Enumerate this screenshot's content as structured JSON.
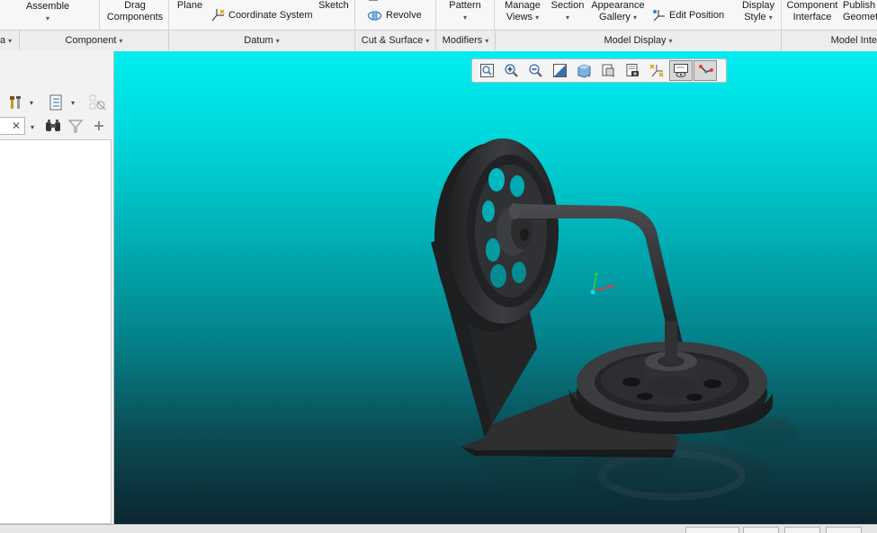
{
  "ribbon": {
    "buttons": {
      "assemble": "Assemble",
      "drag_line1": "Drag",
      "drag_line2": "Components",
      "plane": "Plane",
      "coordinate_system": "Coordinate System",
      "sketch": "Sketch",
      "revolve": "Revolve",
      "pattern": "Pattern",
      "manage_views_line1": "Manage",
      "manage_views_line2": "Views",
      "section": "Section",
      "appearance_line1": "Appearance",
      "appearance_line2": "Gallery",
      "edit_position": "Edit Position",
      "display_style_line1": "Display",
      "display_style_line2": "Style",
      "component_interface_line1": "Component",
      "component_interface_line2": "Interface",
      "publish_line1": "Publish",
      "publish_line2": "Geometry"
    },
    "groups": {
      "operations_partial": "a",
      "component": "Component",
      "datum": "Datum",
      "cut_surface": "Cut & Surface",
      "modifiers": "Modifiers",
      "model_display": "Model Display",
      "model_intent_partial": "Model Inte"
    },
    "caret": "▾"
  },
  "left_panel": {
    "search_clear": "✕",
    "tools": [
      "settings-icon",
      "show-icon",
      "filter-icon",
      "add-icon",
      "find-icon"
    ]
  },
  "view_toolbar": {
    "buttons": [
      "refit",
      "zoom-in",
      "zoom-out",
      "repaint",
      "display-style",
      "saved-orientations",
      "view-manager",
      "datum-display",
      "spin-center",
      "annotation-display"
    ]
  },
  "colors": {
    "viewport_top": "#00eef0",
    "viewport_bottom": "#0b2630",
    "model": "#2b2d2f",
    "axis_x": "#ff3030",
    "axis_y": "#30d030",
    "axis_z": "#00e0ff"
  }
}
